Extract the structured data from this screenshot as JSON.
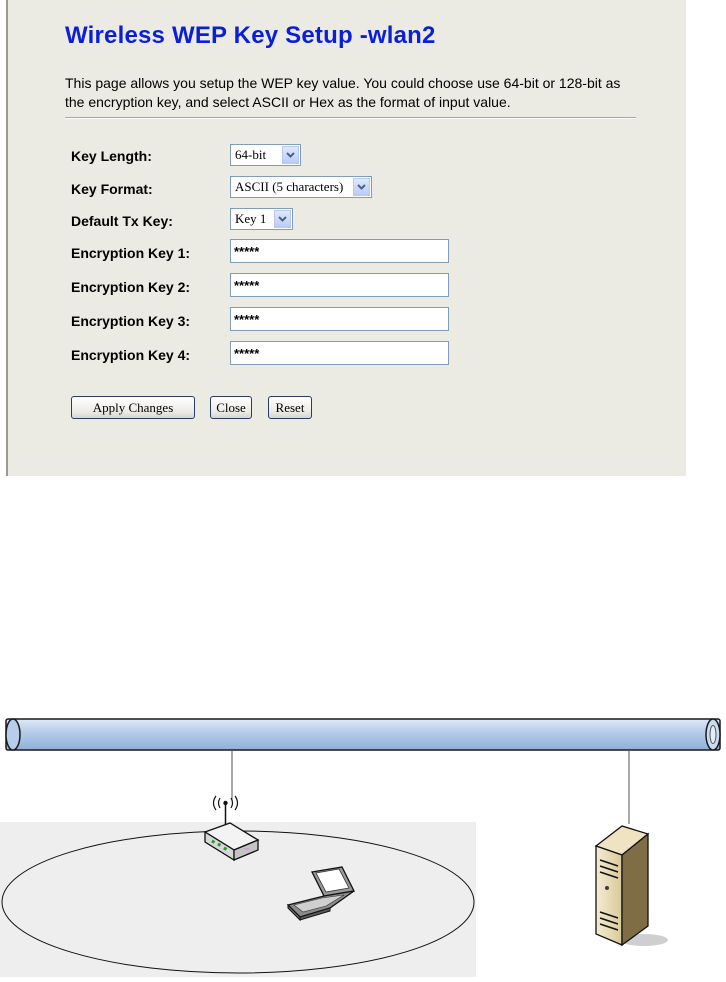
{
  "page": {
    "title": "Wireless WEP Key Setup -wlan2",
    "description": "This page allows you setup the WEP key value. You could choose use 64-bit or 128-bit as the encryption key, and select ASCII or Hex as the format of input value."
  },
  "form": {
    "key_length": {
      "label": "Key Length:",
      "value": "64-bit"
    },
    "key_format": {
      "label": "Key Format:",
      "value": "ASCII (5 characters)"
    },
    "default_tx_key": {
      "label": "Default Tx Key:",
      "value": "Key 1"
    },
    "encryption_keys": [
      {
        "label": "Encryption Key 1:",
        "value": "*****"
      },
      {
        "label": "Encryption Key 2:",
        "value": "*****"
      },
      {
        "label": "Encryption Key 3:",
        "value": "*****"
      },
      {
        "label": "Encryption Key 4:",
        "value": "*****"
      }
    ]
  },
  "buttons": {
    "apply": "Apply Changes",
    "close": "Close",
    "reset": "Reset"
  },
  "icons": {
    "dropdown": "chevron-down-icon",
    "access_point": "wireless-router-icon",
    "laptop": "laptop-icon",
    "server": "server-icon",
    "network": "network-backbone-icon"
  },
  "colors": {
    "title": "#0b1fd6",
    "panel_bg": "#ecebe3",
    "backbone": "#b9d0ec",
    "coverage_bg": "#eeeeee"
  }
}
